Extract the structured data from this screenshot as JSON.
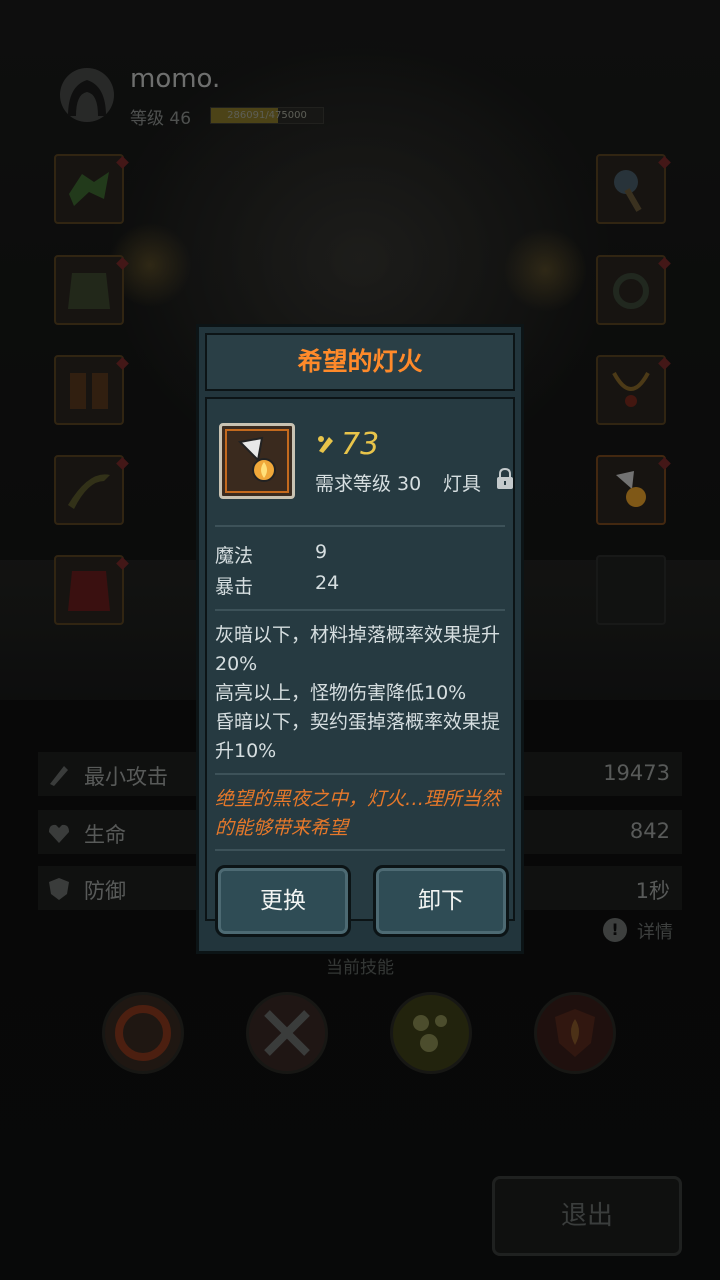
{
  "player": {
    "name": "momo.",
    "level_label": "等级 46",
    "xp_text": "286091/475000",
    "xp_progress": 0.602
  },
  "equipment_slots": {
    "left": [
      "shoulder-armor",
      "chest-armor",
      "boots",
      "ranged-weapon",
      "cloak"
    ],
    "right": [
      "melee-weapon",
      "ring",
      "necklace",
      "lantern",
      "empty-slot"
    ]
  },
  "stats": [
    {
      "icon": "attack-icon",
      "label": "最小攻击",
      "value": "19473"
    },
    {
      "icon": "heart-icon",
      "label": "生命",
      "value": "842"
    },
    {
      "icon": "shield-icon",
      "label": "防御",
      "value": "1秒"
    }
  ],
  "detail_label": "详情",
  "skills_title": "当前技能",
  "skills": [
    "flame-swirl-icon",
    "crossed-axes-icon",
    "bubbles-icon",
    "fire-shield-icon"
  ],
  "exit_label": "退出",
  "popup": {
    "title": "希望的灯火",
    "power": "73",
    "requirement": "需求等级 30",
    "item_type": "灯具",
    "attributes": [
      {
        "name": "魔法",
        "value": "9"
      },
      {
        "name": "暴击",
        "value": "24"
      }
    ],
    "effects": [
      "灰暗以下，材料掉落概率效果提升20%",
      "高亮以上，怪物伤害降低10%",
      "昏暗以下，契约蛋掉落概率效果提升10%"
    ],
    "flavor": "绝望的黑夜之中，灯火…理所当然的能够带来希望",
    "replace_label": "更换",
    "unequip_label": "卸下"
  },
  "colors": {
    "title_orange": "#ff8a2a",
    "power_gold": "#e8c44a",
    "flavor_orange": "#e6782a",
    "panel_bg": "#263a41"
  }
}
